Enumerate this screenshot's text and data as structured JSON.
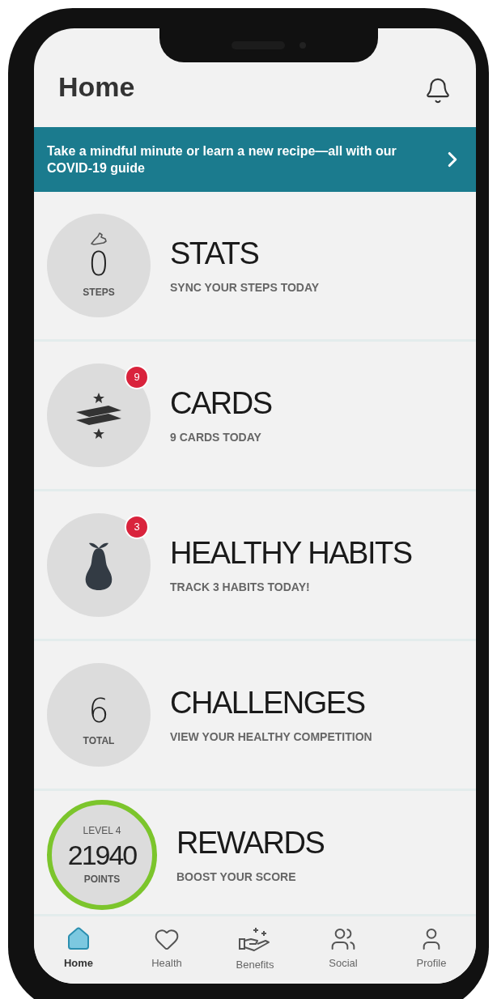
{
  "header": {
    "title": "Home"
  },
  "banner": {
    "text": "Take a mindful minute or learn a new recipe—all with our COVID-19 guide"
  },
  "rows": [
    {
      "kind": "steps",
      "title": "STATS",
      "subtitle": "SYNC YOUR STEPS TODAY",
      "value": "0",
      "unit": "STEPS"
    },
    {
      "kind": "cards",
      "title": "CARDS",
      "subtitle": "9 CARDS TODAY",
      "badge": "9"
    },
    {
      "kind": "habit",
      "title": "HEALTHY HABITS",
      "subtitle": "TRACK 3 HABITS TODAY!",
      "badge": "3"
    },
    {
      "kind": "count",
      "title": "CHALLENGES",
      "subtitle": "VIEW YOUR HEALTHY COMPETITION",
      "value": "6",
      "unit": "TOTAL"
    },
    {
      "kind": "level",
      "title": "REWARDS",
      "subtitle": "BOOST YOUR SCORE",
      "level_label": "LEVEL 4",
      "value": "21940",
      "unit": "POINTS"
    }
  ],
  "nav": [
    {
      "label": "Home",
      "selected": true
    },
    {
      "label": "Health",
      "selected": false
    },
    {
      "label": "Benefits",
      "selected": false
    },
    {
      "label": "Social",
      "selected": false
    },
    {
      "label": "Profile",
      "selected": false
    }
  ]
}
